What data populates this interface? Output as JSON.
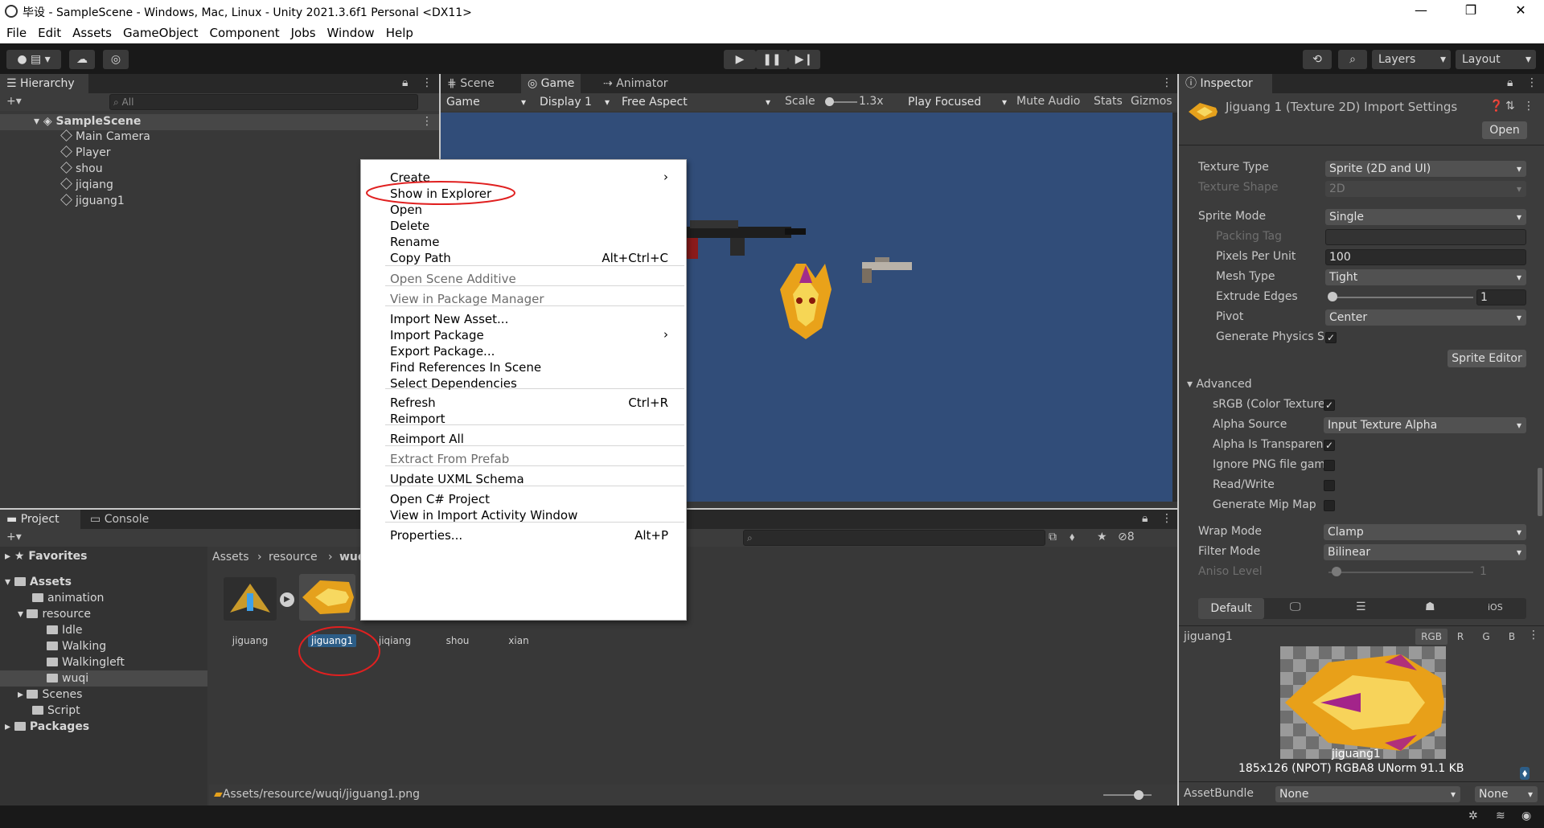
{
  "window": {
    "title": "毕设 - SampleScene - Windows, Mac, Linux - Unity 2021.3.6f1 Personal <DX11>"
  },
  "menubar": [
    "File",
    "Edit",
    "Assets",
    "GameObject",
    "Component",
    "Jobs",
    "Window",
    "Help"
  ],
  "toolbar": {
    "layers": "Layers",
    "layout": "Layout"
  },
  "hierarchy": {
    "tab": "Hierarchy",
    "search_placeholder": "All",
    "scene": "SampleScene",
    "items": [
      "Main Camera",
      "Player",
      "shou",
      "jiqiang",
      "jiguang1"
    ]
  },
  "scene_tabs": [
    "Scene",
    "Game",
    "Animator"
  ],
  "game_bar": {
    "mode": "Game",
    "display": "Display 1",
    "aspect": "Free Aspect",
    "scale_label": "Scale",
    "scale_value": "1.3x",
    "play_focused": "Play Focused",
    "mute": "Mute Audio",
    "stats": "Stats",
    "gizmos": "Gizmos"
  },
  "context_menu": [
    {
      "label": "Create",
      "shortcut": "",
      "submenu": true
    },
    {
      "label": "Show in Explorer",
      "shortcut": ""
    },
    {
      "label": "Open",
      "shortcut": ""
    },
    {
      "label": "Delete",
      "shortcut": ""
    },
    {
      "label": "Rename",
      "shortcut": ""
    },
    {
      "label": "Copy Path",
      "shortcut": "Alt+Ctrl+C"
    },
    {
      "label": "Open Scene Additive",
      "shortcut": "",
      "disabled": true
    },
    {
      "label": "View in Package Manager",
      "shortcut": "",
      "disabled": true
    },
    {
      "label": "Import New Asset...",
      "shortcut": ""
    },
    {
      "label": "Import Package",
      "shortcut": "",
      "submenu": true
    },
    {
      "label": "Export Package...",
      "shortcut": ""
    },
    {
      "label": "Find References In Scene",
      "shortcut": ""
    },
    {
      "label": "Select Dependencies",
      "shortcut": ""
    },
    {
      "label": "Refresh",
      "shortcut": "Ctrl+R"
    },
    {
      "label": "Reimport",
      "shortcut": ""
    },
    {
      "label": "Reimport All",
      "shortcut": ""
    },
    {
      "label": "Extract From Prefab",
      "shortcut": "",
      "disabled": true
    },
    {
      "label": "Update UXML Schema",
      "shortcut": ""
    },
    {
      "label": "Open C# Project",
      "shortcut": ""
    },
    {
      "label": "View in Import Activity Window",
      "shortcut": ""
    },
    {
      "label": "Properties...",
      "shortcut": "Alt+P"
    }
  ],
  "project": {
    "tabs": [
      "Project",
      "Console"
    ],
    "favorites": "Favorites",
    "tree": [
      "Assets",
      "animation",
      "resource",
      "Idle",
      "Walking",
      "Walkingleft",
      "wuqi",
      "Scenes",
      "Script",
      "Packages"
    ],
    "breadcrumb": [
      "Assets",
      "resource",
      "wuqi"
    ],
    "assets": [
      "jiguang",
      "jiguang1",
      "jiqiang",
      "shou",
      "xian"
    ],
    "path": "Assets/resource/wuqi/jiguang1.png",
    "hidden_count": "8"
  },
  "inspector": {
    "tab": "Inspector",
    "title": "Jiguang 1 (Texture 2D) Import Settings",
    "open_btn": "Open",
    "texture_type_label": "Texture Type",
    "texture_type": "Sprite (2D and UI)",
    "texture_shape_label": "Texture Shape",
    "texture_shape": "2D",
    "sprite_mode_label": "Sprite Mode",
    "sprite_mode": "Single",
    "packing_tag_label": "Packing Tag",
    "ppu_label": "Pixels Per Unit",
    "ppu": "100",
    "mesh_type_label": "Mesh Type",
    "mesh_type": "Tight",
    "extrude_label": "Extrude Edges",
    "extrude": "1",
    "pivot_label": "Pivot",
    "pivot": "Center",
    "gen_physics_label": "Generate Physics Shape",
    "sprite_editor": "Sprite Editor",
    "advanced": "Advanced",
    "srgb_label": "sRGB (Color Texture)",
    "alpha_source_label": "Alpha Source",
    "alpha_source": "Input Texture Alpha",
    "alpha_transp_label": "Alpha Is Transparency",
    "ignore_png_label": "Ignore PNG file gamma",
    "readwrite_label": "Read/Write",
    "mipmap_label": "Generate Mip Map",
    "wrap_label": "Wrap Mode",
    "wrap": "Clamp",
    "filter_label": "Filter Mode",
    "filter": "Bilinear",
    "aniso_label": "Aniso Level",
    "aniso": "1",
    "platform_default": "Default",
    "platform_ios": "iOS",
    "preview_name": "jiguang1",
    "channels": [
      "RGB",
      "R",
      "G",
      "B"
    ],
    "preview_caption": "jiguang1",
    "preview_info": "185x126 (NPOT)  RGBA8 UNorm   91.1 KB",
    "assetbundle_label": "AssetBundle",
    "assetbundle": "None",
    "variant": "None"
  },
  "colors": {
    "accent": "#2c5d87",
    "game_bg": "#314d79",
    "annotation": "#e02020"
  }
}
